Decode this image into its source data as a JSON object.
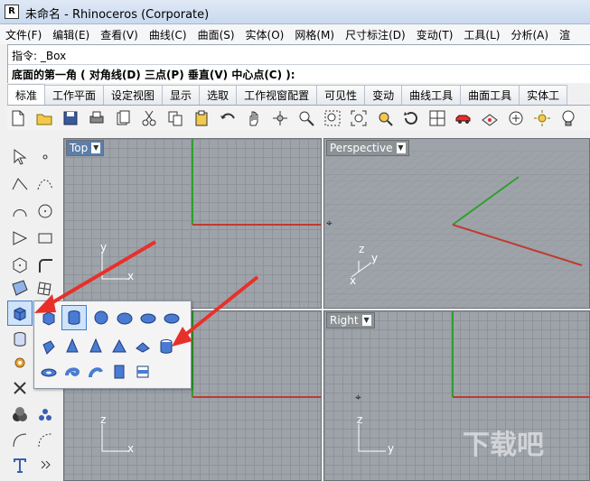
{
  "window": {
    "title": "未命名 - Rhinoceros (Corporate)"
  },
  "menu": [
    "文件(F)",
    "编辑(E)",
    "查看(V)",
    "曲线(C)",
    "曲面(S)",
    "实体(O)",
    "网格(M)",
    "尺寸标注(D)",
    "变动(T)",
    "工具(L)",
    "分析(A)",
    "渲"
  ],
  "command": {
    "prompt": "指令: _Box",
    "options": "底面的第一角 ( 对角线(D)  三点(P)  垂直(V)  中心点(C) ):"
  },
  "tabs": [
    "标准",
    "工作平面",
    "设定视图",
    "显示",
    "选取",
    "工作视窗配置",
    "可见性",
    "变动",
    "曲线工具",
    "曲面工具",
    "实体工"
  ],
  "toolbar_icons": [
    "new-icon",
    "open-icon",
    "save-icon",
    "print-icon",
    "import-icon",
    "cut-icon",
    "copy-icon",
    "paste-icon",
    "undo-icon",
    "pan-icon",
    "rotate-view-icon",
    "zoom-icon",
    "zoom-window-icon",
    "zoom-extents-icon",
    "zoom-selected-icon",
    "rotate-icon",
    "four-viewports-icon",
    "car-icon",
    "analysis-icon",
    "target-icon",
    "sun-icon",
    "lightbulb-icon"
  ],
  "viewports": {
    "top": {
      "label": "Top",
      "axis_x": "x",
      "axis_y": "y"
    },
    "perspective": {
      "label": "Perspective",
      "axis_x": "x",
      "axis_y": "y",
      "axis_z": "z"
    },
    "front": {
      "axis_x": "x",
      "axis_z": "z"
    },
    "right": {
      "label": "Right",
      "axis_y": "y",
      "axis_z": "z"
    }
  },
  "lefttool_icons": [
    "select-icon",
    "point-icon",
    "polyline-icon",
    "curve-icon",
    "arc-icon",
    "circle-icon",
    "freeform-icon",
    "rectangle-icon",
    "polygon-icon",
    "fillet-curve-icon",
    "surface-icon",
    "network-surface-icon",
    "box-icon",
    "more-icon",
    "cylinder-icon",
    "gear-icon",
    "scissors-icon",
    "boolean-icon",
    "blend-icon",
    "text-icon",
    "expand-icon"
  ],
  "flyout_icons": [
    "box-icon",
    "cylinder-icon",
    "sphere-icon",
    "ellipsoid-icon",
    "ellipsoid-2-icon",
    "paraboloid-icon",
    "pyramid-icon",
    "cone-icon",
    "truncated-cone-icon",
    "pyramid-2-icon",
    "truncated-pyramid-icon",
    "tube-icon",
    "torus-icon",
    "pipe-icon",
    "pipe-2-icon",
    "extrude-icon",
    "extrude-2-icon"
  ],
  "colors": {
    "x_axis": "#c03a30",
    "y_axis": "#2ea02e",
    "arrow": "#e8302a",
    "viewport_bg": "#9ea3a9",
    "active_label": "#5c7ea8"
  },
  "watermark": "下载吧"
}
